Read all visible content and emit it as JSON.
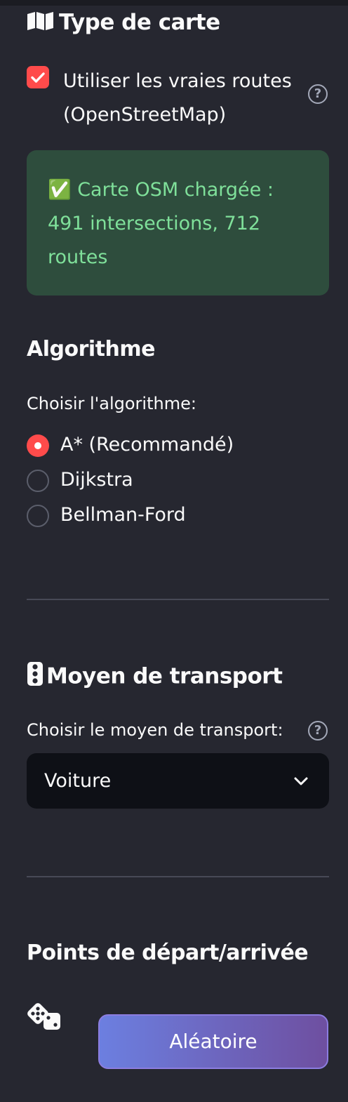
{
  "map_type": {
    "title": "Type de carte",
    "osm_checkbox": {
      "label": "Utiliser les vraies routes (OpenStreetMap)",
      "checked": true
    },
    "status_message": "✅ Carte OSM chargée : 491 intersections, 712 routes"
  },
  "algorithm": {
    "title": "Algorithme",
    "prompt": "Choisir l'algorithme:",
    "options": [
      "A* (Recommandé)",
      "Dijkstra",
      "Bellman-Ford"
    ],
    "selected_index": 0
  },
  "transport": {
    "title": "Moyen de transport",
    "prompt": "Choisir le moyen de transport:",
    "selected": "Voiture"
  },
  "points": {
    "title": "Points de départ/arrivée",
    "random_button": "Aléatoire"
  },
  "colors": {
    "accent": "#ff4b4b",
    "background": "#262730",
    "success_bg": "#2e4d3d",
    "success_text": "#7fe09a"
  },
  "icons": [
    "map-icon",
    "question-circle-icon",
    "traffic-light-icon",
    "chevron-down-icon",
    "dice-icon"
  ]
}
